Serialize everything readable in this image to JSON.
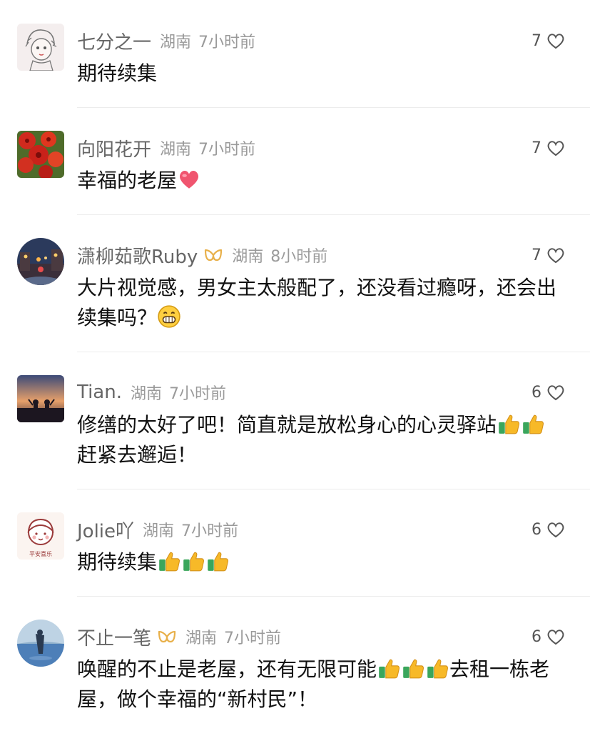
{
  "comments": [
    {
      "name": "七分之一",
      "badge": false,
      "location": "湖南",
      "time": "7小时前",
      "likes": "7",
      "parts": [
        {
          "t": "期待续集"
        }
      ],
      "avatar": "avatar-sketch-girl"
    },
    {
      "name": "向阳花开",
      "badge": false,
      "location": "湖南",
      "time": "7小时前",
      "likes": "7",
      "parts": [
        {
          "t": "幸福的老屋"
        },
        {
          "e": "heart"
        }
      ],
      "avatar": "avatar-red-flowers"
    },
    {
      "name": "潇柳茹歌Ruby",
      "badge": true,
      "location": "湖南",
      "time": "8小时前",
      "likes": "7",
      "parts": [
        {
          "t": "大片视觉感，男女主太般配了，还没看过瘾呀，还会出续集吗？"
        },
        {
          "e": "grin"
        }
      ],
      "avatar": "avatar-night-street"
    },
    {
      "name": "Tian.",
      "badge": false,
      "location": "湖南",
      "time": "7小时前",
      "likes": "6",
      "parts": [
        {
          "t": "修缮的太好了吧！简直就是放松身心的心灵驿站"
        },
        {
          "e": "thumb"
        },
        {
          "e": "thumb"
        },
        {
          "t": " 赶紧去邂逅！"
        }
      ],
      "avatar": "avatar-sunset-silhouette"
    },
    {
      "name": "Jolie吖",
      "badge": false,
      "location": "湖南",
      "time": "7小时前",
      "likes": "6",
      "parts": [
        {
          "t": "期待续集"
        },
        {
          "e": "thumb"
        },
        {
          "e": "thumb"
        },
        {
          "e": "thumb"
        }
      ],
      "avatar": "avatar-cartoon-girl",
      "avatar_caption": "平安喜乐"
    },
    {
      "name": "不止一笔",
      "badge": true,
      "location": "湖南",
      "time": "7小时前",
      "likes": "6",
      "parts": [
        {
          "t": "唤醒的不止是老屋，还有无限可能"
        },
        {
          "e": "thumb"
        },
        {
          "e": "thumb"
        },
        {
          "e": "thumb"
        },
        {
          "t": "去租一栋老屋，做个幸福的“新村民”！"
        }
      ],
      "avatar": "avatar-lake-blue"
    }
  ],
  "colors": {
    "name": "#666666",
    "meta": "#9a9a9a",
    "text": "#111111",
    "badge": "#e8b04a",
    "separator": "#ececec"
  }
}
